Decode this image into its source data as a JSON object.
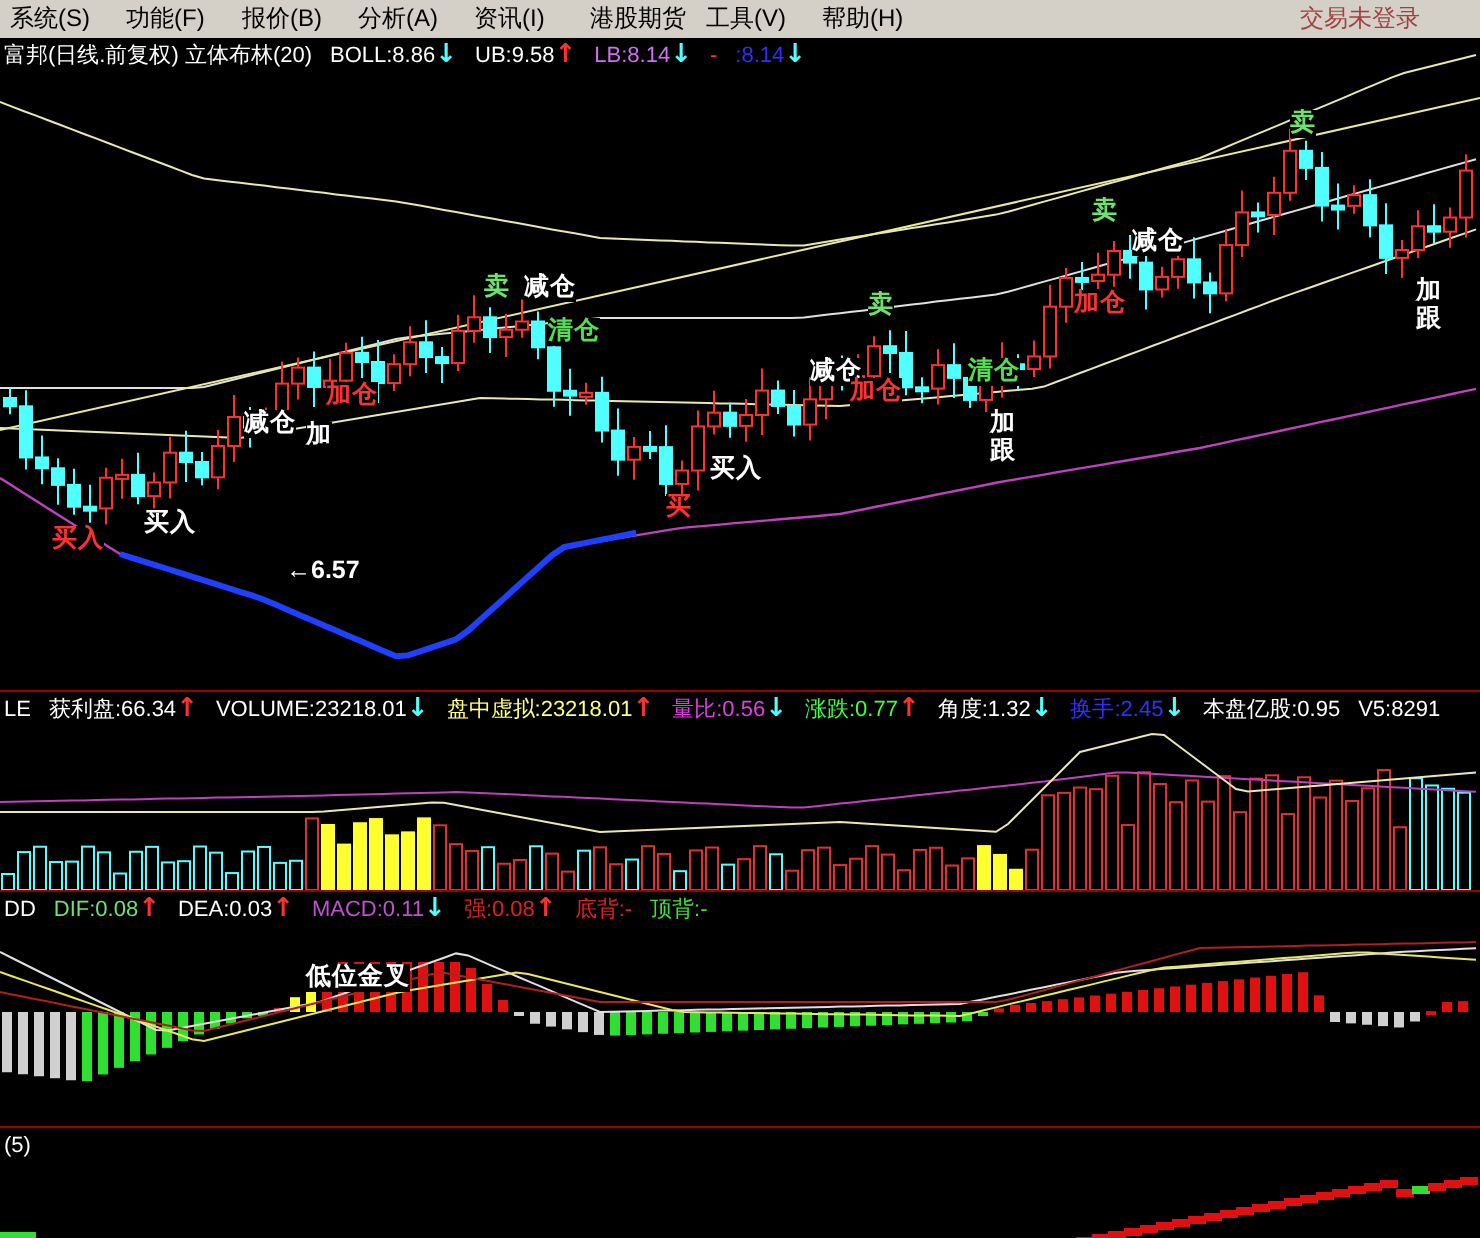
{
  "menu": {
    "items": [
      "系统(S)",
      "功能(F)",
      "报价(B)",
      "分析(A)",
      "资讯(I)",
      "港股期货",
      "工具(V)",
      "帮助(H)"
    ],
    "status": "交易未登录"
  },
  "panels": [
    {
      "kind": "price",
      "header": [
        {
          "text": "富邦(日线.前复权) 立体布林(20)",
          "color": "#ffffff"
        },
        {
          "text": "BOLL:8.86",
          "color": "#ffffff",
          "arrow": {
            "text": "↓",
            "color": "#50ffff"
          }
        },
        {
          "text": "UB:9.58",
          "color": "#ffffff",
          "arrow": {
            "text": "↑",
            "color": "#ff3030"
          }
        },
        {
          "text": "LB:8.14",
          "color": "#d070f0",
          "arrow": {
            "text": "↓",
            "color": "#50ffff"
          }
        },
        {
          "text": "-",
          "color": "#ff3030"
        },
        {
          "text": ":8.14",
          "color": "#3030ff",
          "arrow": {
            "text": "↓",
            "color": "#50ffff"
          }
        }
      ],
      "labels": [
        {
          "text": "卖",
          "color": "#70e070"
        },
        {
          "text": "减仓",
          "color": "#ffffff"
        },
        {
          "text": "清仓",
          "color": "#50e050"
        },
        {
          "text": "减仓",
          "color": "#ffffff"
        },
        {
          "text": "加仓",
          "color": "#ff3030"
        },
        {
          "text": "加",
          "color": "#ffffff"
        },
        {
          "text": "买入",
          "color": "#ffffff"
        },
        {
          "text": "买入",
          "color": "#ff3030"
        },
        {
          "text": "←6.57",
          "color": "#ffffff"
        },
        {
          "text": "买",
          "color": "#ff3030"
        },
        {
          "text": "买入",
          "color": "#ffffff"
        },
        {
          "text": "卖",
          "color": "#70e070"
        },
        {
          "text": "减仓",
          "color": "#ffffff"
        },
        {
          "text": "加仓",
          "color": "#ff3030"
        },
        {
          "text": "清仓",
          "color": "#50e050"
        },
        {
          "text": "加跟",
          "color": "#ffffff"
        },
        {
          "text": "卖",
          "color": "#70e070"
        },
        {
          "text": "减仓",
          "color": "#ffffff"
        },
        {
          "text": "加仓",
          "color": "#ff3030"
        },
        {
          "text": "卖",
          "color": "#70e070"
        },
        {
          "text": "加跟",
          "color": "#ffffff"
        }
      ]
    },
    {
      "kind": "volume",
      "header": [
        {
          "text": "LE",
          "color": "#ffffff"
        },
        {
          "text": "获利盘:66.34",
          "color": "#ffffff",
          "arrow": {
            "text": "↑",
            "color": "#ff3030"
          }
        },
        {
          "text": "VOLUME:23218.01",
          "color": "#ffffff",
          "arrow": {
            "text": "↓",
            "color": "#50ffff"
          }
        },
        {
          "text": "盘中虚拟:23218.01",
          "color": "#ffff80",
          "arrow": {
            "text": "↑",
            "color": "#ff3030"
          }
        },
        {
          "text": "量比:0.56",
          "color": "#e040e0",
          "arrow": {
            "text": "↓",
            "color": "#50ffff"
          }
        },
        {
          "text": "涨跌:0.77",
          "color": "#40ff40",
          "arrow": {
            "text": "↑",
            "color": "#ff3030"
          }
        },
        {
          "text": "角度:1.32",
          "color": "#ffffff",
          "arrow": {
            "text": "↓",
            "color": "#50ffff"
          }
        },
        {
          "text": "换手:2.45",
          "color": "#3030ff",
          "arrow": {
            "text": "↓",
            "color": "#50ffff"
          }
        },
        {
          "text": "本盘亿股:0.95",
          "color": "#ffffff"
        },
        {
          "text": "V5:8291",
          "color": "#ffffff"
        }
      ]
    },
    {
      "kind": "macd",
      "header": [
        {
          "text": "DD",
          "color": "#ffffff"
        },
        {
          "text": "DIF:0.08",
          "color": "#70e070",
          "arrow": {
            "text": "↑",
            "color": "#ff3030"
          }
        },
        {
          "text": "DEA:0.03",
          "color": "#ffffff",
          "arrow": {
            "text": "↑",
            "color": "#ff3030"
          }
        },
        {
          "text": "MACD:0.11",
          "color": "#c050d0",
          "arrow": {
            "text": "↓",
            "color": "#50ffff"
          }
        },
        {
          "text": "强:0.08",
          "color": "#e02020",
          "arrow": {
            "text": "↑",
            "color": "#ff3030"
          }
        },
        {
          "text": "底背:-",
          "color": "#e02020"
        },
        {
          "text": "顶背:-",
          "color": "#40e040"
        }
      ],
      "labels": [
        {
          "text": "低位金叉",
          "color": "#ffffff"
        }
      ]
    },
    {
      "kind": "trend",
      "header": [
        {
          "text": "(5)",
          "color": "#ffffff"
        }
      ]
    }
  ]
}
